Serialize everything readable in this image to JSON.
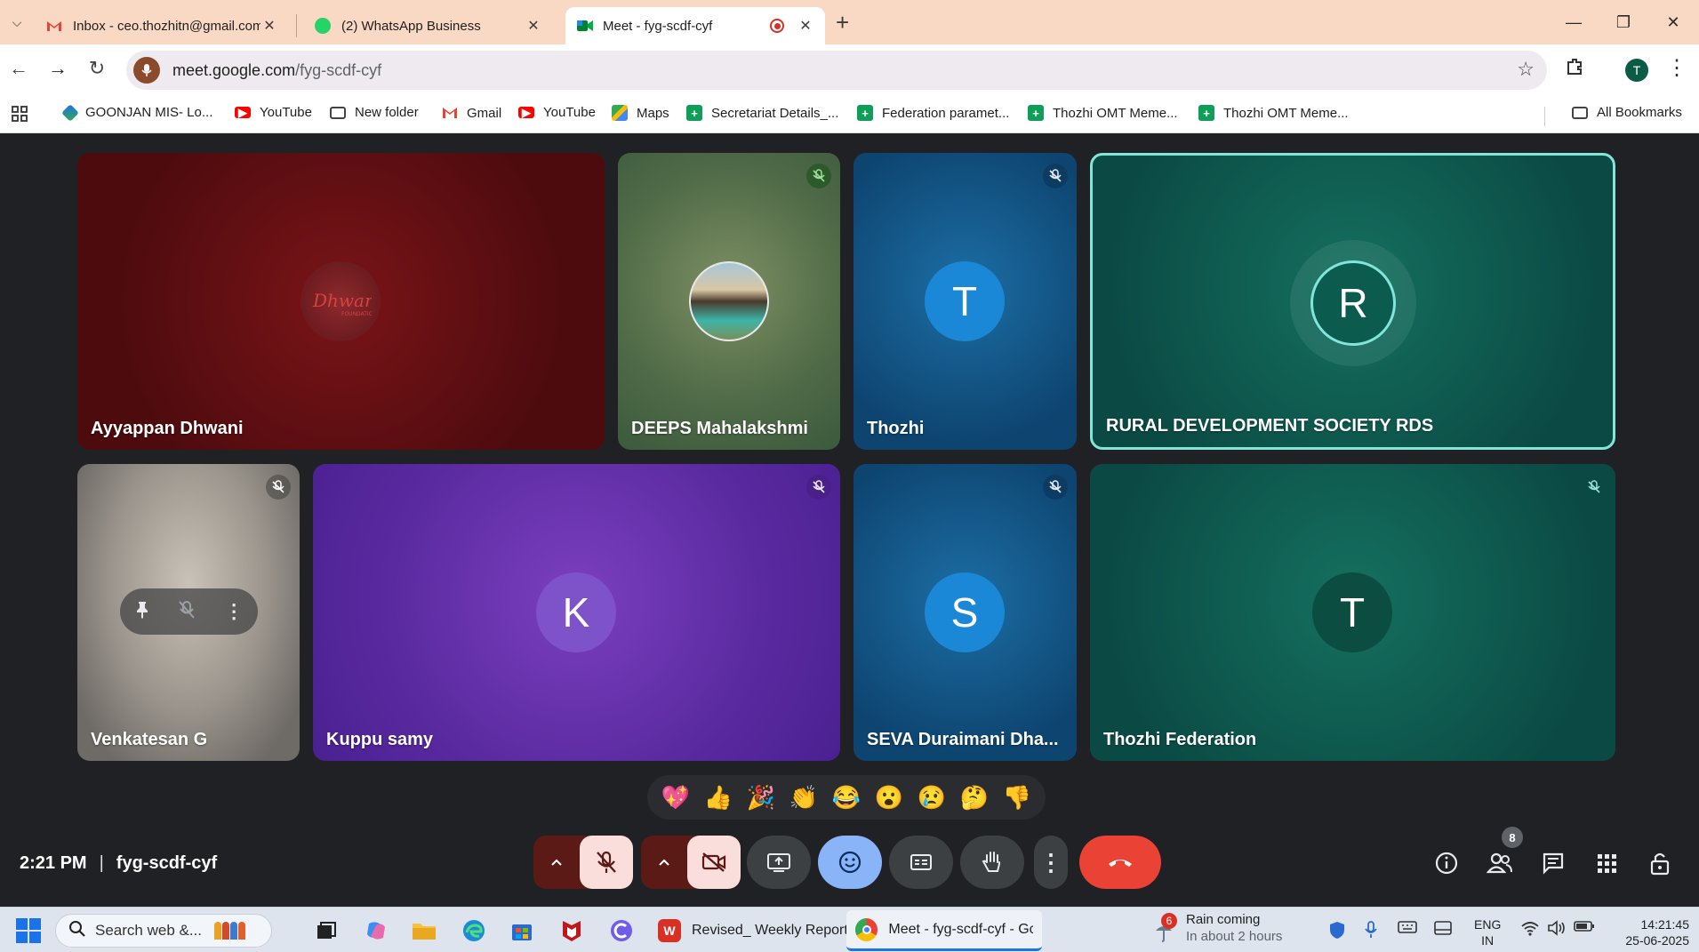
{
  "browser": {
    "tabs": [
      {
        "title": "Inbox - ceo.thozhitn@gmail.com",
        "active": false,
        "favicon": "gmail-icon"
      },
      {
        "title": "(2) WhatsApp Business",
        "active": false,
        "favicon": "whatsapp-icon"
      },
      {
        "title": "Meet - fyg-scdf-cyf",
        "active": true,
        "favicon": "meet-icon",
        "recording": true
      }
    ],
    "new_tab": "+",
    "address": {
      "host": "meet.google.com",
      "path": "/fyg-scdf-cyf"
    },
    "profile_initial": "T",
    "bookmarks": [
      {
        "label": "GOONJAN MIS- Lo...",
        "icon": "goonjan-icon"
      },
      {
        "label": "YouTube",
        "icon": "youtube-icon"
      },
      {
        "label": "New folder",
        "icon": "folder-icon"
      },
      {
        "label": "Gmail",
        "icon": "gmail-icon"
      },
      {
        "label": "YouTube",
        "icon": "youtube-icon"
      },
      {
        "label": "Maps",
        "icon": "maps-icon"
      },
      {
        "label": "Secretariat Details_...",
        "icon": "sheets-icon"
      },
      {
        "label": "Federation paramet...",
        "icon": "sheets-icon"
      },
      {
        "label": "Thozhi OMT Meme...",
        "icon": "sheets-icon"
      },
      {
        "label": "Thozhi OMT Meme...",
        "icon": "sheets-icon"
      }
    ],
    "all_bookmarks": "All Bookmarks"
  },
  "meet": {
    "participants": [
      {
        "name": "Ayyappan Dhwani",
        "avatar": "dhwani-logo",
        "muted": false
      },
      {
        "name": "DEEPS Mahalakshmi",
        "avatar": "photo",
        "muted": true
      },
      {
        "name": "Thozhi",
        "initial": "T",
        "muted": true
      },
      {
        "name": "RURAL DEVELOPMENT SOCIETY RDS",
        "initial": "R",
        "muted": false,
        "speaking": true
      },
      {
        "name": "Venkatesan G",
        "avatar": "video",
        "muted": true
      },
      {
        "name": "Kuppu samy",
        "initial": "K",
        "muted": true
      },
      {
        "name": "SEVA Duraimani Dha...",
        "initial": "S",
        "muted": true
      },
      {
        "name": "Thozhi Federation",
        "initial": "T",
        "muted": true
      }
    ],
    "reactions": [
      "💖",
      "👍",
      "🎉",
      "👏",
      "😂",
      "😮",
      "😢",
      "🤔",
      "👎"
    ],
    "time": "2:21 PM",
    "meeting_code": "fyg-scdf-cyf",
    "participant_count": "8"
  },
  "taskbar": {
    "search_placeholder": "Search web &...",
    "apps": [
      {
        "label": "Revised_ Weekly Report",
        "icon": "wps-icon"
      },
      {
        "label": "Meet - fyg-scdf-cyf - Gc",
        "icon": "chrome-icon",
        "active": true
      }
    ],
    "weather": {
      "title": "Rain coming",
      "subtitle": "In about 2 hours",
      "badge": "6"
    },
    "language": {
      "line1": "ENG",
      "line2": "IN"
    },
    "clock": {
      "time": "14:21:45",
      "date": "25-06-2025"
    }
  },
  "colors": {
    "meet_bg": "#202124",
    "speaking_border": "#81e6d9",
    "end_call": "#ea4335",
    "reaction_active": "#8ab4f8"
  }
}
